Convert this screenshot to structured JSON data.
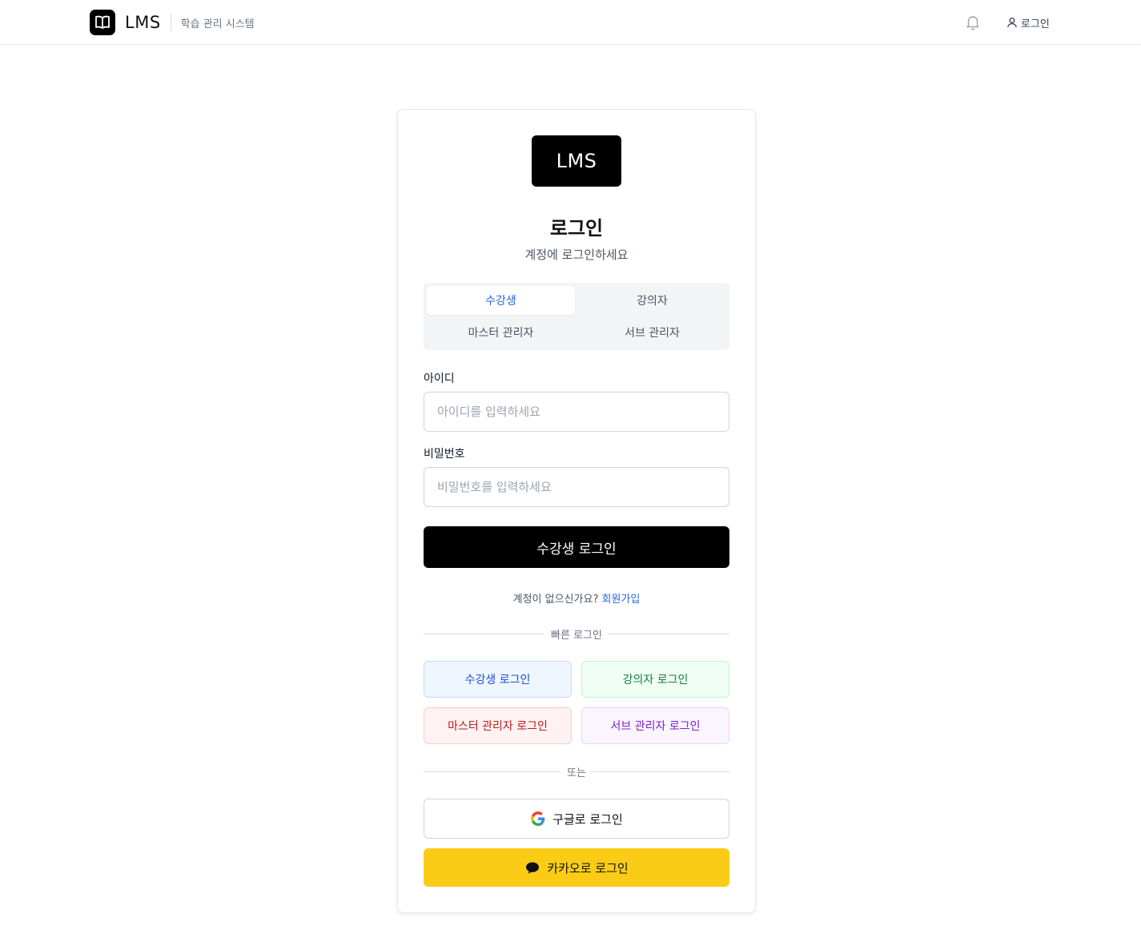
{
  "header": {
    "brand_name": "LMS",
    "brand_subtitle": "학습 관리 시스템",
    "login_label": "로그인"
  },
  "card": {
    "logo_text": "LMS",
    "title": "로그인",
    "subtitle": "계정에 로그인하세요",
    "tabs": [
      {
        "label": "수강생",
        "active": true
      },
      {
        "label": "강의자",
        "active": false
      },
      {
        "label": "마스터 관리자",
        "active": false
      },
      {
        "label": "서브 관리자",
        "active": false
      }
    ],
    "id_label": "아이디",
    "id_placeholder": "아이디를 입력하세요",
    "id_value": "",
    "pw_label": "비밀번호",
    "pw_placeholder": "비밀번호를 입력하세요",
    "pw_value": "",
    "submit_label": "수강생 로그인",
    "signup_prompt": "계정이 없으신가요?",
    "signup_link": "회원가입",
    "quick_divider": "빠른 로그인",
    "quick": {
      "student": "수강생 로그인",
      "instructor": "강의자 로그인",
      "master": "마스터 관리자 로그인",
      "sub": "서브 관리자 로그인"
    },
    "or_divider": "또는",
    "google_label": "구글로 로그인",
    "kakao_label": "카카오로 로그인"
  },
  "colors": {
    "accent": "#2563eb",
    "primary_button": "#000000",
    "kakao": "#facc15"
  },
  "icons": {
    "brand": "book-open-icon",
    "notification": "bell-icon",
    "user": "user-icon",
    "google": "google-icon",
    "kakao": "chat-bubble-icon"
  }
}
